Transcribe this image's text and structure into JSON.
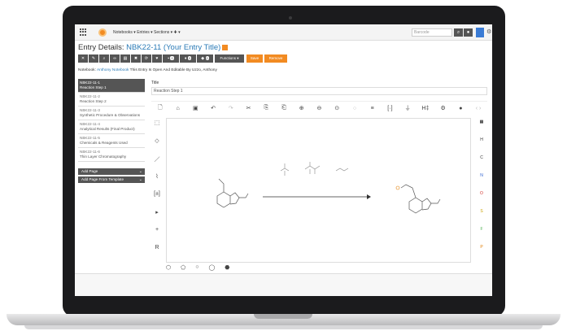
{
  "nav": {
    "menus": "Notebooks ▾   Entries ▾   Sections ▾   ✚ ▾",
    "barcode_placeholder": "Barcode"
  },
  "entry": {
    "title_prefix": "Entry Details: ",
    "title_link": "NBK22-11 (Your Entry Title)"
  },
  "toolbar": {
    "badge1": "0",
    "badge2": "0",
    "badge3": "0",
    "functions_label": "Functions ▾",
    "save_label": "Save",
    "remove_label": "Remove"
  },
  "notebook_line": {
    "prefix": "Notebook: ",
    "link": "Anthony Notebook",
    "suffix": "  This Entry Is Open And Editable By Uzzo, Anthony"
  },
  "sidebar": {
    "items": [
      {
        "id": "NBK22-11-1",
        "label": "Reaction Step 1",
        "active": true
      },
      {
        "id": "NBK22-11-2",
        "label": "Reaction Step 2",
        "active": false
      },
      {
        "id": "NBK22-11-3",
        "label": "Synthetic Procedure & Observations",
        "active": false
      },
      {
        "id": "NBK22-11-4",
        "label": "Analytical Results (Final Product)",
        "active": false
      },
      {
        "id": "NBK22-11-5",
        "label": "Chemicals & Reagents Used",
        "active": false
      },
      {
        "id": "NBK22-11-6",
        "label": "Thin Layer Chromatography",
        "active": false
      }
    ],
    "add_page": "Add Page",
    "add_from_template": "Add Page From Template"
  },
  "main": {
    "title_label": "Title",
    "title_value": "Reaction Step 1"
  },
  "editor": {
    "right_elements": [
      "H",
      "C",
      "N",
      "O",
      "S",
      "F",
      "P"
    ],
    "right_colors": [
      "#333333",
      "#333333",
      "#2a5fd0",
      "#d0342c",
      "#c9a000",
      "#4caf50",
      "#e07b00"
    ]
  }
}
